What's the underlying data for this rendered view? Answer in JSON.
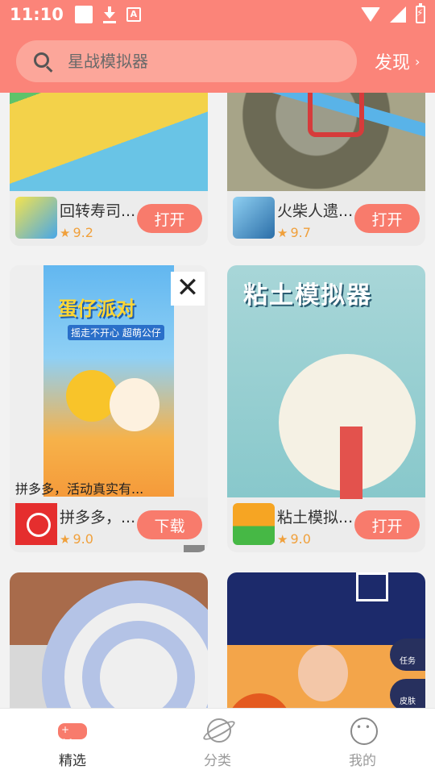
{
  "status_bar": {
    "time": "11:10"
  },
  "search": {
    "placeholder": "星战模拟器",
    "discover_label": "发现",
    "discover_chevron": "›"
  },
  "cards": [
    {
      "name": "回转寿司...",
      "rating": "9.2",
      "button": "打开"
    },
    {
      "name": "火柴人遗...",
      "rating": "9.7",
      "button": "打开"
    },
    {
      "name": "拼多多，...",
      "rating": "9.0",
      "button": "下载",
      "ad_caption": "拼多多，活动真实有...",
      "ad_title": "蛋仔派对",
      "ad_sub": "摇走不开心 超萌公仔",
      "close_glyph": "✕"
    },
    {
      "name": "粘土模拟...",
      "rating": "9.0",
      "button": "打开",
      "art_title": "粘土模拟器"
    },
    {
      "name": "",
      "rating": "",
      "button": ""
    },
    {
      "name": "",
      "rating": "",
      "button": "",
      "side_labels": [
        "任务",
        "皮肤"
      ]
    }
  ],
  "rating_star": "★",
  "bottom_nav": [
    {
      "label": "精选",
      "icon": "gamepad-icon",
      "active": true
    },
    {
      "label": "分类",
      "icon": "planet-icon",
      "active": false
    },
    {
      "label": "我的",
      "icon": "smile-icon",
      "active": false
    }
  ],
  "colors": {
    "header": "#fb8479",
    "accent": "#f87b6c",
    "rating": "#f0a03b"
  }
}
